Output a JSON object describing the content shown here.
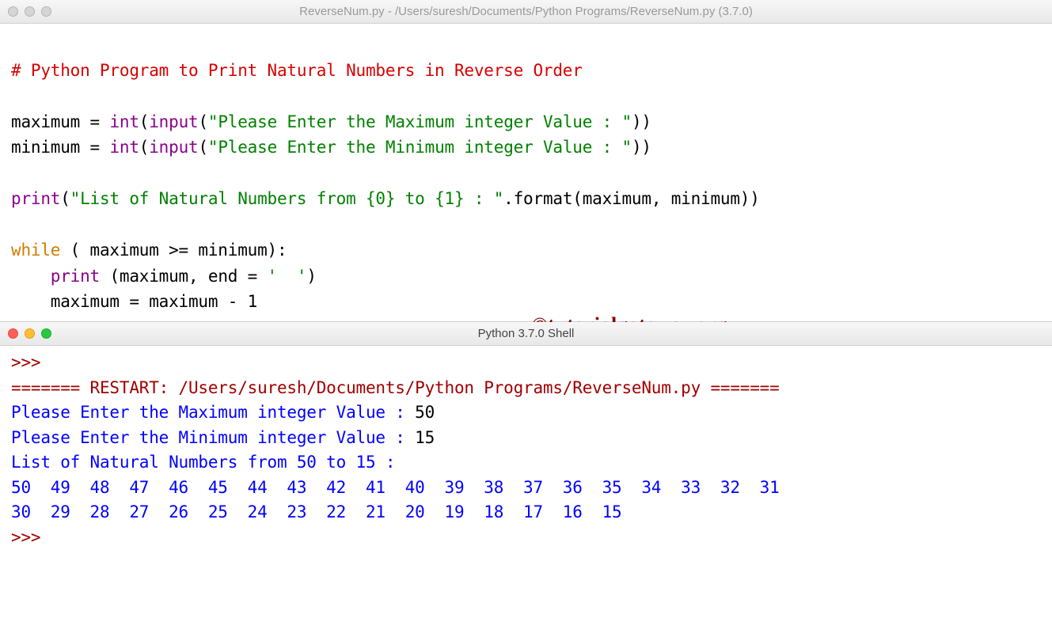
{
  "editor_window": {
    "title": "ReverseNum.py - /Users/suresh/Documents/Python Programs/ReverseNum.py (3.7.0)"
  },
  "code": {
    "comment": "# Python Program to Print Natural Numbers in Reverse Order",
    "l1_var": "maximum = ",
    "l1_int": "int",
    "l1_p1": "(",
    "l1_input": "input",
    "l1_p2": "(",
    "l1_str": "\"Please Enter the Maximum integer Value : \"",
    "l1_p3": "))",
    "l2_var": "minimum = ",
    "l2_int": "int",
    "l2_p1": "(",
    "l2_input": "input",
    "l2_p2": "(",
    "l2_str": "\"Please Enter the Minimum integer Value : \"",
    "l2_p3": "))",
    "l3_print": "print",
    "l3_p1": "(",
    "l3_str": "\"List of Natural Numbers from {0} to {1} : \"",
    "l3_tail": ".format(maximum, minimum))",
    "l4_while": "while",
    "l4_cond": " ( maximum >= minimum):",
    "l5_indent": "    ",
    "l5_print": "print",
    "l5_args1": " (maximum, end = ",
    "l5_str": "'  '",
    "l5_args2": ")",
    "l6": "    maximum = maximum - 1"
  },
  "watermark": "©tutorialgateway.org",
  "shell_window": {
    "title": "Python 3.7.0 Shell"
  },
  "shell": {
    "prompt": ">>> ",
    "restart": "======= RESTART: /Users/suresh/Documents/Python Programs/ReverseNum.py =======",
    "in1_label": "Please Enter the Maximum integer Value : ",
    "in1_val": "50",
    "in2_label": "Please Enter the Minimum integer Value : ",
    "in2_val": "15",
    "listline": "List of Natural Numbers from 50 to 15 : ",
    "row1": "50  49  48  47  46  45  44  43  42  41  40  39  38  37  36  35  34  33  32  31  ",
    "row2": "30  29  28  27  26  25  24  23  22  21  20  19  18  17  16  15  "
  }
}
